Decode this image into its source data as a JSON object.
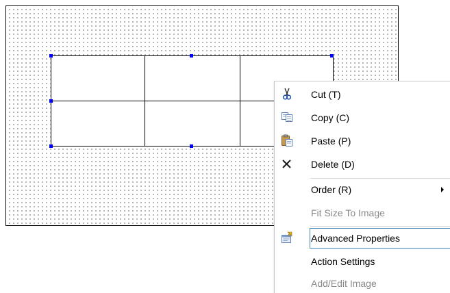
{
  "context_menu": {
    "items": [
      {
        "label": "Cut (T)",
        "icon": "scissors-icon",
        "enabled": true
      },
      {
        "label": "Copy (C)",
        "icon": "copy-icon",
        "enabled": true
      },
      {
        "label": "Paste (P)",
        "icon": "paste-icon",
        "enabled": true
      },
      {
        "label": "Delete (D)",
        "icon": "delete-icon",
        "enabled": true
      },
      {
        "label": "Order (R)",
        "icon": null,
        "enabled": true,
        "submenu": true
      },
      {
        "label": "Fit Size To Image",
        "icon": null,
        "enabled": false
      },
      {
        "label": "Advanced Properties",
        "icon": "properties-icon",
        "enabled": true,
        "highlighted": true
      },
      {
        "label": "Action Settings",
        "icon": null,
        "enabled": true
      },
      {
        "label": "Add/Edit Image",
        "icon": null,
        "enabled": false
      }
    ]
  },
  "design_canvas": {
    "table": {
      "rows": 2,
      "columns": 3
    },
    "handle_color": "#0000ff"
  },
  "colors": {
    "highlight_border": "#3c7fb1",
    "disabled_text": "#8a8a8a"
  }
}
